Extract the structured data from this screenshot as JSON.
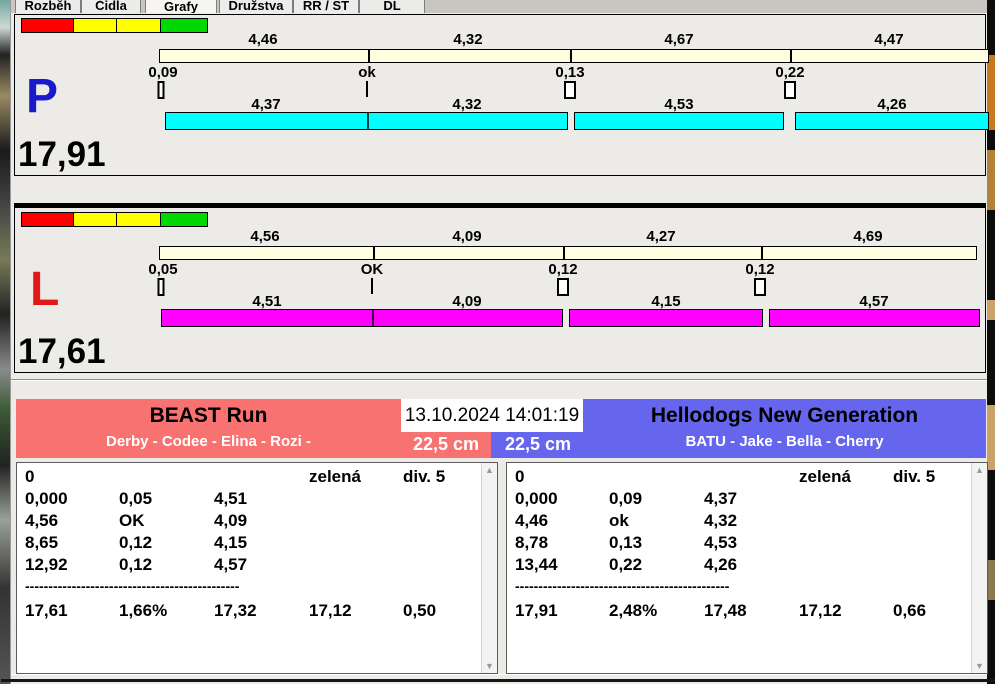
{
  "tabs": [
    "Rozběh",
    "Čidla",
    "Grafy",
    "Družstva",
    "RR / ST",
    "DL"
  ],
  "p_panel": {
    "letter": "P",
    "total": "17,91",
    "top_values": [
      "4,46",
      "4,32",
      "4,67",
      "4,47"
    ],
    "gap_values": [
      "0,09",
      "ok",
      "0,13",
      "0,22"
    ],
    "bar_values": [
      "4,37",
      "4,32",
      "4,53",
      "4,26"
    ]
  },
  "l_panel": {
    "letter": "L",
    "total": "17,61",
    "top_values": [
      "4,56",
      "4,09",
      "4,27",
      "4,69"
    ],
    "gap_values": [
      "0,05",
      "OK",
      "0,12",
      "0,12"
    ],
    "bar_values": [
      "4,51",
      "4,09",
      "4,15",
      "4,57"
    ]
  },
  "colors": {
    "status_squares": [
      "#ff0000",
      "#ffff00",
      "#ffff00",
      "#00d800"
    ],
    "p_bar": "#00ffff",
    "l_bar": "#ff00ff",
    "scale_bar": "#ffffe0",
    "left_team_bg": "#f87272",
    "right_team_bg": "#6565ee",
    "p_letter": "#1a1acc",
    "l_letter": "#e01818"
  },
  "header": {
    "datetime": "13.10.2024 14:01:19",
    "left": {
      "team": "BEAST Run",
      "dogs": "Derby - Codee - Elina - Rozi -",
      "height": "22,5 cm"
    },
    "right": {
      "team": "Hellodogs New Generation",
      "dogs": "BATU - Jake - Bella - Cherry",
      "height": "22,5 cm"
    }
  },
  "left_table": {
    "first_row": [
      "0",
      "zelená",
      "div. 5"
    ],
    "rows": [
      [
        "0,000",
        "0,05",
        "4,51"
      ],
      [
        "4,56",
        "OK",
        "4,09"
      ],
      [
        "8,65",
        "0,12",
        "4,15"
      ],
      [
        "12,92",
        "0,12",
        "4,57"
      ]
    ],
    "separator": "----------------------------------------------",
    "totals": [
      "17,61",
      "1,66%",
      "17,32",
      "17,12",
      "0,50"
    ]
  },
  "right_table": {
    "first_row": [
      "0",
      "zelená",
      "div. 5"
    ],
    "rows": [
      [
        "0,000",
        "0,09",
        "4,37"
      ],
      [
        "4,46",
        "ok",
        "4,32"
      ],
      [
        "8,78",
        "0,13",
        "4,53"
      ],
      [
        "13,44",
        "0,22",
        "4,26"
      ]
    ],
    "separator": "----------------------------------------------",
    "totals": [
      "17,91",
      "2,48%",
      "17,48",
      "17,12",
      "0,66"
    ]
  }
}
